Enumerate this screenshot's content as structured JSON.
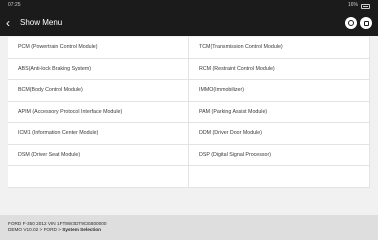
{
  "status": {
    "time": "07:25",
    "battery": "16%"
  },
  "titlebar": {
    "title": "Show Menu"
  },
  "menu_items": [
    "PCM (Powertrain Control Module)",
    "TCM(Transmission Control Module)",
    "ABS(Anti-lock Braking System)",
    "RCM (Restraint Control Module)",
    "BCM(Body Control Module)",
    "IMMO(Immobilizer)",
    "APIM (Accessory Protocol Interface Module)",
    "PAM (Parking Assist Module)",
    "ICM1 (Information Center Module)",
    "DDM (Driver Door Module)",
    "DSM (Driver Seat Module)",
    "DSP (Digital Signal Processor)",
    "",
    ""
  ],
  "footer": {
    "vehicle": "FORD  F-350  2012  VIN  1FT8W3DT9CEB00000",
    "path_prefix": "DEMO V10.02 > FORD > ",
    "path_current": "System Selection"
  }
}
